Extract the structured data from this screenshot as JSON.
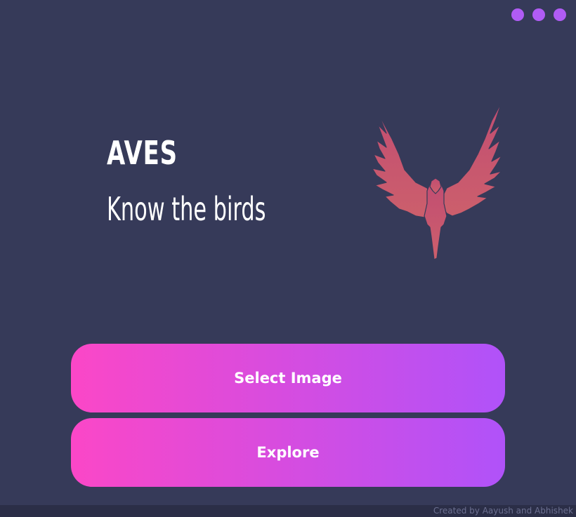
{
  "window_controls": {
    "dots": [
      "dot-icon",
      "dot-icon",
      "dot-icon"
    ],
    "color": "#b05cf5"
  },
  "hero": {
    "title": "AVES",
    "subtitle": "Know the birds",
    "logo_icon": "bird-logo-icon",
    "logo_color": "#c8546e"
  },
  "actions": {
    "select_image_label": "Select Image",
    "explore_label": "Explore",
    "gradient_start": "#fb47c7",
    "gradient_end": "#b052f9"
  },
  "footer": {
    "credit": "Created by Aayush and Abhishek"
  },
  "theme": {
    "background": "#363a59",
    "footer_background": "#2b2e47"
  }
}
